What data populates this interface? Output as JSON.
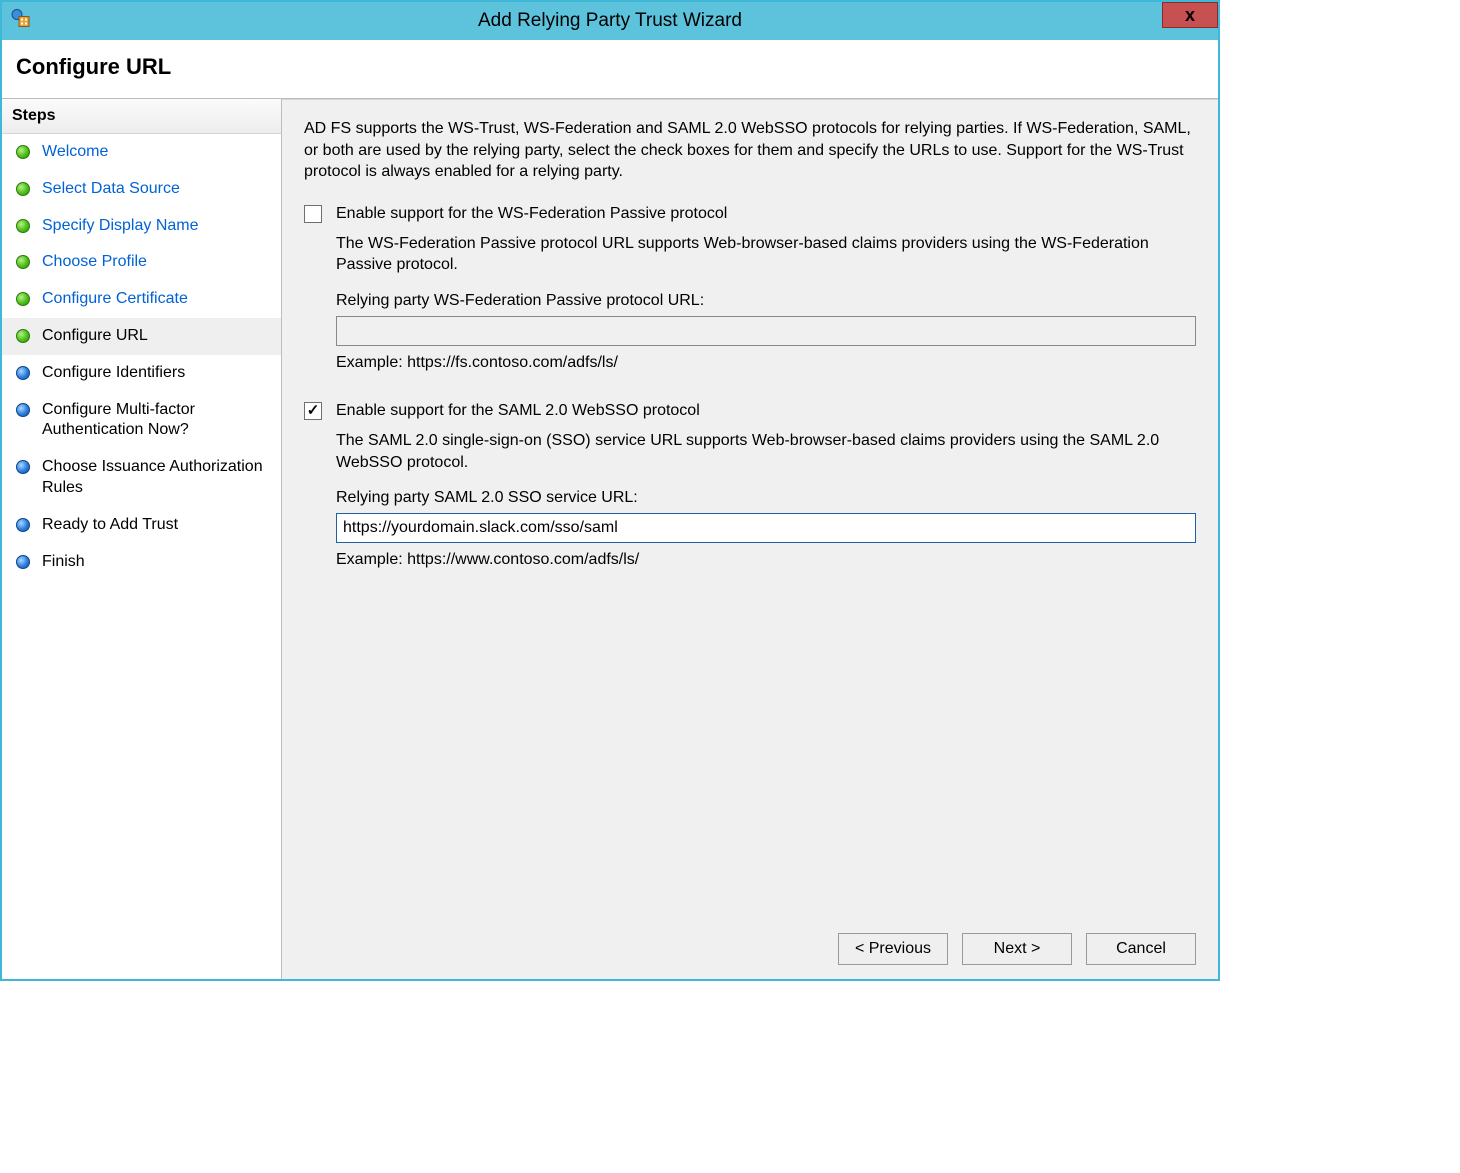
{
  "titlebar": {
    "title": "Add Relying Party Trust Wizard"
  },
  "header": {
    "title": "Configure URL"
  },
  "sidebar": {
    "header": "Steps",
    "items": [
      {
        "label": "Welcome",
        "state": "done"
      },
      {
        "label": "Select Data Source",
        "state": "done"
      },
      {
        "label": "Specify Display Name",
        "state": "done"
      },
      {
        "label": "Choose Profile",
        "state": "done"
      },
      {
        "label": "Configure Certificate",
        "state": "done"
      },
      {
        "label": "Configure URL",
        "state": "current"
      },
      {
        "label": "Configure Identifiers",
        "state": "todo"
      },
      {
        "label": "Configure Multi-factor Authentication Now?",
        "state": "todo"
      },
      {
        "label": "Choose Issuance Authorization Rules",
        "state": "todo"
      },
      {
        "label": "Ready to Add Trust",
        "state": "todo"
      },
      {
        "label": "Finish",
        "state": "todo"
      }
    ]
  },
  "main": {
    "intro": "AD FS supports the WS-Trust, WS-Federation and SAML 2.0 WebSSO protocols for relying parties.  If WS-Federation, SAML, or both are used by the relying party, select the check boxes for them and specify the URLs to use.  Support for the WS-Trust protocol is always enabled for a relying party.",
    "wsfed": {
      "checkbox_label": "Enable support for the WS-Federation Passive protocol",
      "checked": false,
      "desc": "The WS-Federation Passive protocol URL supports Web-browser-based claims providers using the WS-Federation Passive protocol.",
      "field_label": "Relying party WS-Federation Passive protocol URL:",
      "value": "",
      "example": "Example: https://fs.contoso.com/adfs/ls/"
    },
    "saml": {
      "checkbox_label": "Enable support for the SAML 2.0 WebSSO protocol",
      "checked": true,
      "desc": "The SAML 2.0 single-sign-on (SSO) service URL supports Web-browser-based claims providers using the SAML 2.0 WebSSO protocol.",
      "field_label": "Relying party SAML 2.0 SSO service URL:",
      "value": "https://yourdomain.slack.com/sso/saml",
      "example": "Example: https://www.contoso.com/adfs/ls/"
    }
  },
  "buttons": {
    "previous": "< Previous",
    "next": "Next >",
    "cancel": "Cancel"
  }
}
